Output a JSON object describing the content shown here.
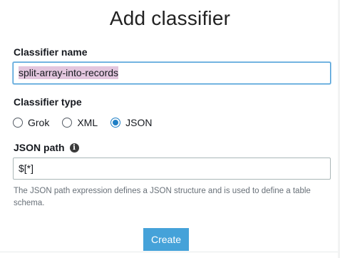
{
  "dialog": {
    "title": "Add classifier"
  },
  "classifier_name": {
    "label": "Classifier name",
    "value": "split-array-into-records"
  },
  "classifier_type": {
    "label": "Classifier type",
    "options": [
      {
        "label": "Grok",
        "selected": false
      },
      {
        "label": "XML",
        "selected": false
      },
      {
        "label": "JSON",
        "selected": true
      }
    ]
  },
  "json_path": {
    "label": "JSON path",
    "info_icon": "info-icon",
    "value": "$[*]",
    "help": "The JSON path expression defines a JSON structure and is used to define a table schema."
  },
  "actions": {
    "create_label": "Create"
  },
  "colors": {
    "accent": "#1f7fc5",
    "button": "#45a2d9",
    "selection_highlight": "#e3c6de"
  }
}
